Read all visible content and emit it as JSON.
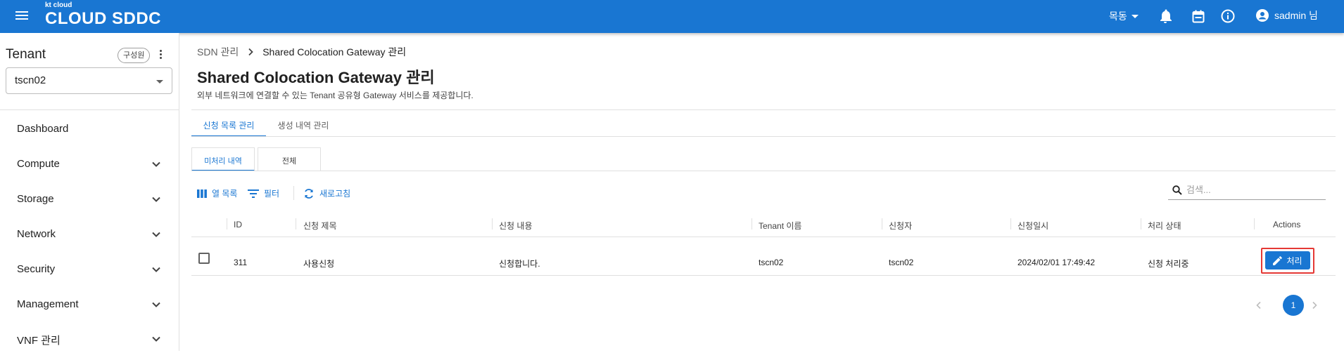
{
  "topbar": {
    "logo_small": "kt cloud",
    "logo_main": "CLOUD SDDC",
    "region": "목동",
    "user_name": "sadmin 님"
  },
  "sidebar": {
    "tenant_title": "Tenant",
    "member_chip": "구성원",
    "tenant_selected": "tscn02",
    "nav": [
      {
        "label": "Dashboard"
      },
      {
        "label": "Compute"
      },
      {
        "label": "Storage"
      },
      {
        "label": "Network"
      },
      {
        "label": "Security"
      },
      {
        "label": "Management"
      },
      {
        "label": "VNF 관리"
      }
    ]
  },
  "breadcrumb": {
    "parent": "SDN 관리",
    "current": "Shared Colocation Gateway 관리"
  },
  "page": {
    "title": "Shared Colocation Gateway 관리",
    "description": "외부 네트워크에 연결할 수 있는 Tenant 공유형 Gateway 서비스를 제공합니다."
  },
  "tabs": [
    {
      "label": "신청 목록 관리"
    },
    {
      "label": "생성 내역 관리"
    }
  ],
  "subtabs": [
    {
      "label": "미처리 내역"
    },
    {
      "label": "전체"
    }
  ],
  "toolbar": {
    "columns": "열 목록",
    "filter": "필터",
    "refresh": "새로고침",
    "search_placeholder": "검색..."
  },
  "table": {
    "headers": [
      "ID",
      "신청 제목",
      "신청 내용",
      "Tenant 이름",
      "신청자",
      "신청일시",
      "처리 상태",
      "Actions"
    ],
    "rows": [
      {
        "id": "311",
        "title": "사용신청",
        "content": "신청합니다.",
        "tenant": "tscn02",
        "applicant": "tscn02",
        "date": "2024/02/01 17:49:42",
        "status": "신청 처리중",
        "action": "처리"
      }
    ]
  },
  "pagination": {
    "current_page": "1"
  },
  "colors": {
    "primary": "#1976d2",
    "highlight": "#e53935"
  }
}
